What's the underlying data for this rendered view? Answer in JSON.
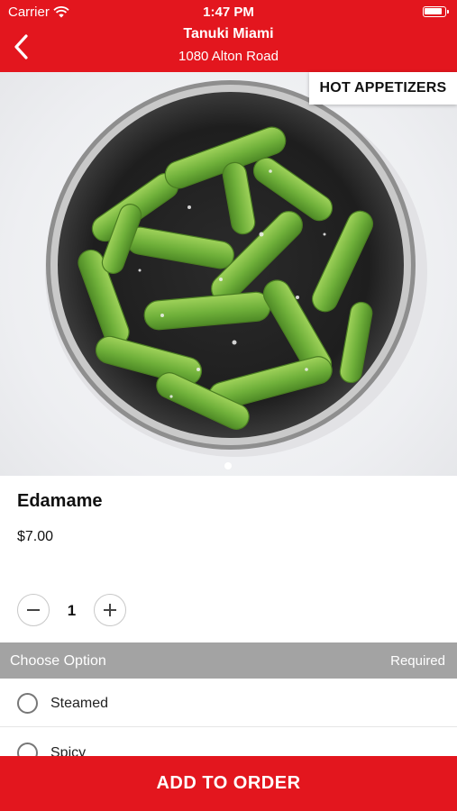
{
  "status_bar": {
    "carrier": "Carrier",
    "time": "1:47 PM"
  },
  "nav": {
    "title": "Tanuki Miami",
    "subtitle": "1080 Alton Road"
  },
  "category_tag": "HOT APPETIZERS",
  "item": {
    "name": "Edamame",
    "price": "$7.00",
    "quantity": "1"
  },
  "options": {
    "title": "Choose Option",
    "required_label": "Required",
    "items": [
      {
        "label": "Steamed"
      },
      {
        "label": "Spicy"
      }
    ]
  },
  "add_button": "ADD TO ORDER",
  "colors": {
    "brand_red": "#e3161e",
    "option_header_gray": "#a3a3a3"
  },
  "icons": [
    "wifi-icon",
    "battery-icon",
    "back-chevron-icon",
    "minus-icon",
    "plus-icon",
    "radio-icon"
  ]
}
